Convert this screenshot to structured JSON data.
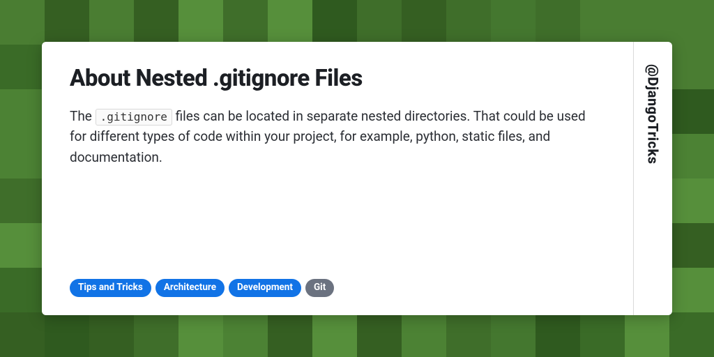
{
  "title": "About Nested .gitignore Files",
  "description_pre": "The ",
  "description_code": ".gitignore",
  "description_post": " files can be located in separate nested directories. That could be used for different types of code within your project, for example, python, static files, and documentation.",
  "tags": [
    {
      "label": "Tips and Tricks",
      "color": "blue"
    },
    {
      "label": "Architecture",
      "color": "blue"
    },
    {
      "label": "Development",
      "color": "blue"
    },
    {
      "label": "Git",
      "color": "grey"
    }
  ],
  "handle": "@DjangoTricks",
  "bg_palette": [
    "#2f5a1f",
    "#3a6b27",
    "#44772f",
    "#4c8234",
    "#568f3b",
    "#3f6e2a",
    "#355f22",
    "#4a7d32"
  ]
}
